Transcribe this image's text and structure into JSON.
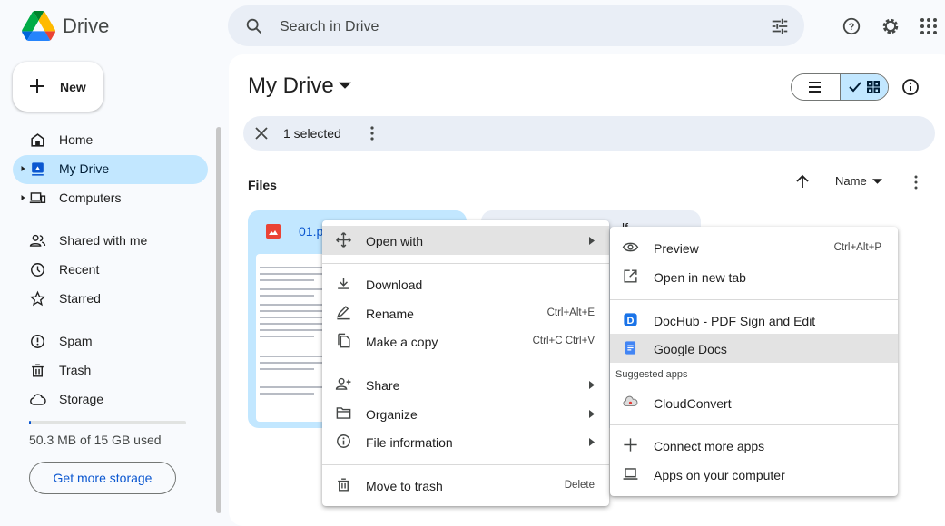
{
  "app": {
    "title": "Drive"
  },
  "search": {
    "placeholder": "Search in Drive"
  },
  "header": {
    "icons": [
      "help-icon",
      "settings-icon",
      "apps-icon"
    ]
  },
  "sidebar": {
    "new_label": "New",
    "items": [
      {
        "label": "Home",
        "icon": "home-icon"
      },
      {
        "label": "My Drive",
        "icon": "my-drive-icon",
        "active": true
      },
      {
        "label": "Computers",
        "icon": "computers-icon"
      },
      {
        "label": "Shared with me",
        "icon": "shared-icon"
      },
      {
        "label": "Recent",
        "icon": "clock-icon"
      },
      {
        "label": "Starred",
        "icon": "star-icon"
      },
      {
        "label": "Spam",
        "icon": "spam-icon"
      },
      {
        "label": "Trash",
        "icon": "trash-icon"
      },
      {
        "label": "Storage",
        "icon": "cloud-icon"
      }
    ],
    "storage": {
      "used_text": "50.3 MB of 15 GB used",
      "used_fraction": 0.003,
      "button": "Get more storage"
    }
  },
  "main": {
    "title": "My Drive",
    "selection": {
      "text": "1 selected"
    },
    "section": "Files",
    "sort": {
      "label": "Name",
      "direction": "ascending"
    },
    "files": [
      {
        "name": "01.p",
        "type": "image"
      },
      {
        "name": "lf",
        "type": "other"
      }
    ]
  },
  "context_menu": {
    "items": [
      {
        "label": "Open with",
        "shortcut": "",
        "submenu": true
      },
      {
        "label": "Download",
        "shortcut": ""
      },
      {
        "label": "Rename",
        "shortcut": "Ctrl+Alt+E"
      },
      {
        "label": "Make a copy",
        "shortcut": "Ctrl+C Ctrl+V"
      },
      {
        "label": "Share",
        "shortcut": "",
        "submenu": true
      },
      {
        "label": "Organize",
        "shortcut": "",
        "submenu": true
      },
      {
        "label": "File information",
        "shortcut": "",
        "submenu": true
      },
      {
        "label": "Move to trash",
        "shortcut": "Delete"
      }
    ]
  },
  "submenu": {
    "items": [
      {
        "label": "Preview",
        "shortcut": "Ctrl+Alt+P"
      },
      {
        "label": "Open in new tab"
      },
      {
        "label": "DocHub - PDF Sign and Edit"
      },
      {
        "label": "Google Docs"
      },
      {
        "label": "CloudConvert"
      },
      {
        "label": "Connect more apps"
      },
      {
        "label": "Apps on your computer"
      }
    ],
    "suggested_header": "Suggested apps"
  },
  "colors": {
    "accent": "#0b57d0",
    "selected_bg": "#c2e7ff",
    "search_bg": "#e9eef6",
    "page_bg": "#f8fafd"
  }
}
